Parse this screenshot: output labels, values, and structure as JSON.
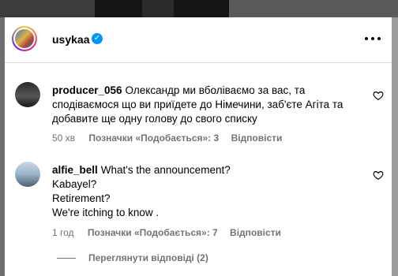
{
  "post": {
    "author": "usykaa",
    "verified": true
  },
  "comments": [
    {
      "username": "producer_056",
      "text_lines": [
        "Олександр ми вболіваємо за вас, та",
        "сподіваємося що ви приїдете до Німечини, заб'єте Агіта та",
        "добавите ще одну голову до свого списку"
      ],
      "time": "50 хв",
      "likes": "Позначки «Подобається»: 3",
      "reply": "Відповісти"
    },
    {
      "username": "alfie_bell",
      "text_lines": [
        "What's the announcement?",
        "Kabayel?",
        "Retirement?",
        "We're itching to know ."
      ],
      "time": "1 год",
      "likes": "Позначки «Подобається»: 7",
      "reply": "Відповісти"
    }
  ],
  "view_replies": "Переглянути відповіді (2)",
  "colors": {
    "verified": "#0095f6",
    "meta_text": "#737373",
    "divider": "#dbdbdb"
  }
}
